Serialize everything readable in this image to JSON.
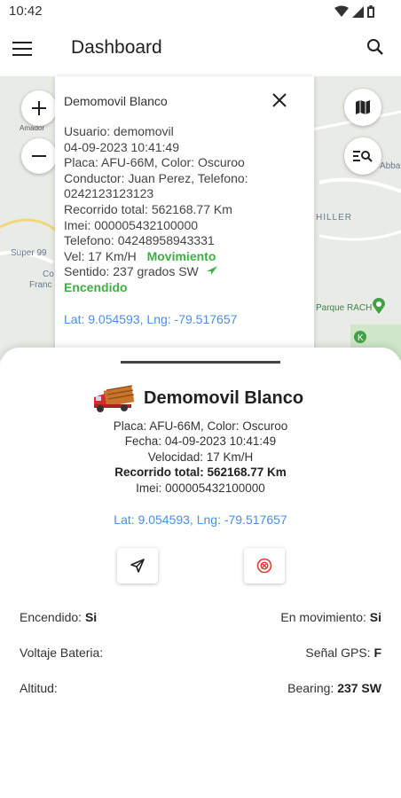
{
  "status_bar": {
    "time": "10:42"
  },
  "app_bar": {
    "title": "Dashboard"
  },
  "map": {
    "labels": [
      "Amador",
      "Super 99",
      "Co",
      "Franc",
      "HILLER",
      "Abba",
      "Parque RACH"
    ]
  },
  "info_window": {
    "name": "Demomovil Blanco",
    "usuario": "Usuario: demomovil",
    "datetime": "04-09-2023 10:41:49",
    "placa": "Placa: AFU-66M, Color: Oscuroo",
    "conductor": "Conductor: Juan Perez, Telefono:",
    "conductor_phone": "0242123123123",
    "recorrido": "Recorrido total: 562168.77 Km",
    "imei": "Imei: 000005432100000",
    "telefono": "Telefono: 04248958943331",
    "vel": "Vel: 17 Km/H",
    "movimiento": "Movimiento",
    "sentido": "Sentido: 237 grados SW",
    "encendido": "Encendido",
    "latlng": "Lat: 9.054593, Lng: -79.517657"
  },
  "sheet": {
    "vehicle_name": "Demomovil Blanco",
    "placa": "Placa: AFU-66M, Color: Oscuroo",
    "fecha": "Fecha: 04-09-2023 10:41:49",
    "velocidad": "Velocidad: 17 Km/H",
    "recorrido": "Recorrido total: 562168.77 Km",
    "imei": "Imei: 000005432100000",
    "latlng": "Lat: 9.054593, Lng: -79.517657",
    "stats": {
      "encendido_label": "Encendido:",
      "encendido_value": "Si",
      "movimiento_label": "En movimiento:",
      "movimiento_value": "Si",
      "voltaje_label": "Voltaje Bateria:",
      "senal_label": "Señal GPS:",
      "senal_value": "F",
      "altitud_label": "Altitud:",
      "bearing_label": "Bearing:",
      "bearing_value": "237 SW"
    }
  },
  "colors": {
    "link": "#4a8ee8",
    "green": "#3cb043",
    "stop_red": "#e53935"
  }
}
